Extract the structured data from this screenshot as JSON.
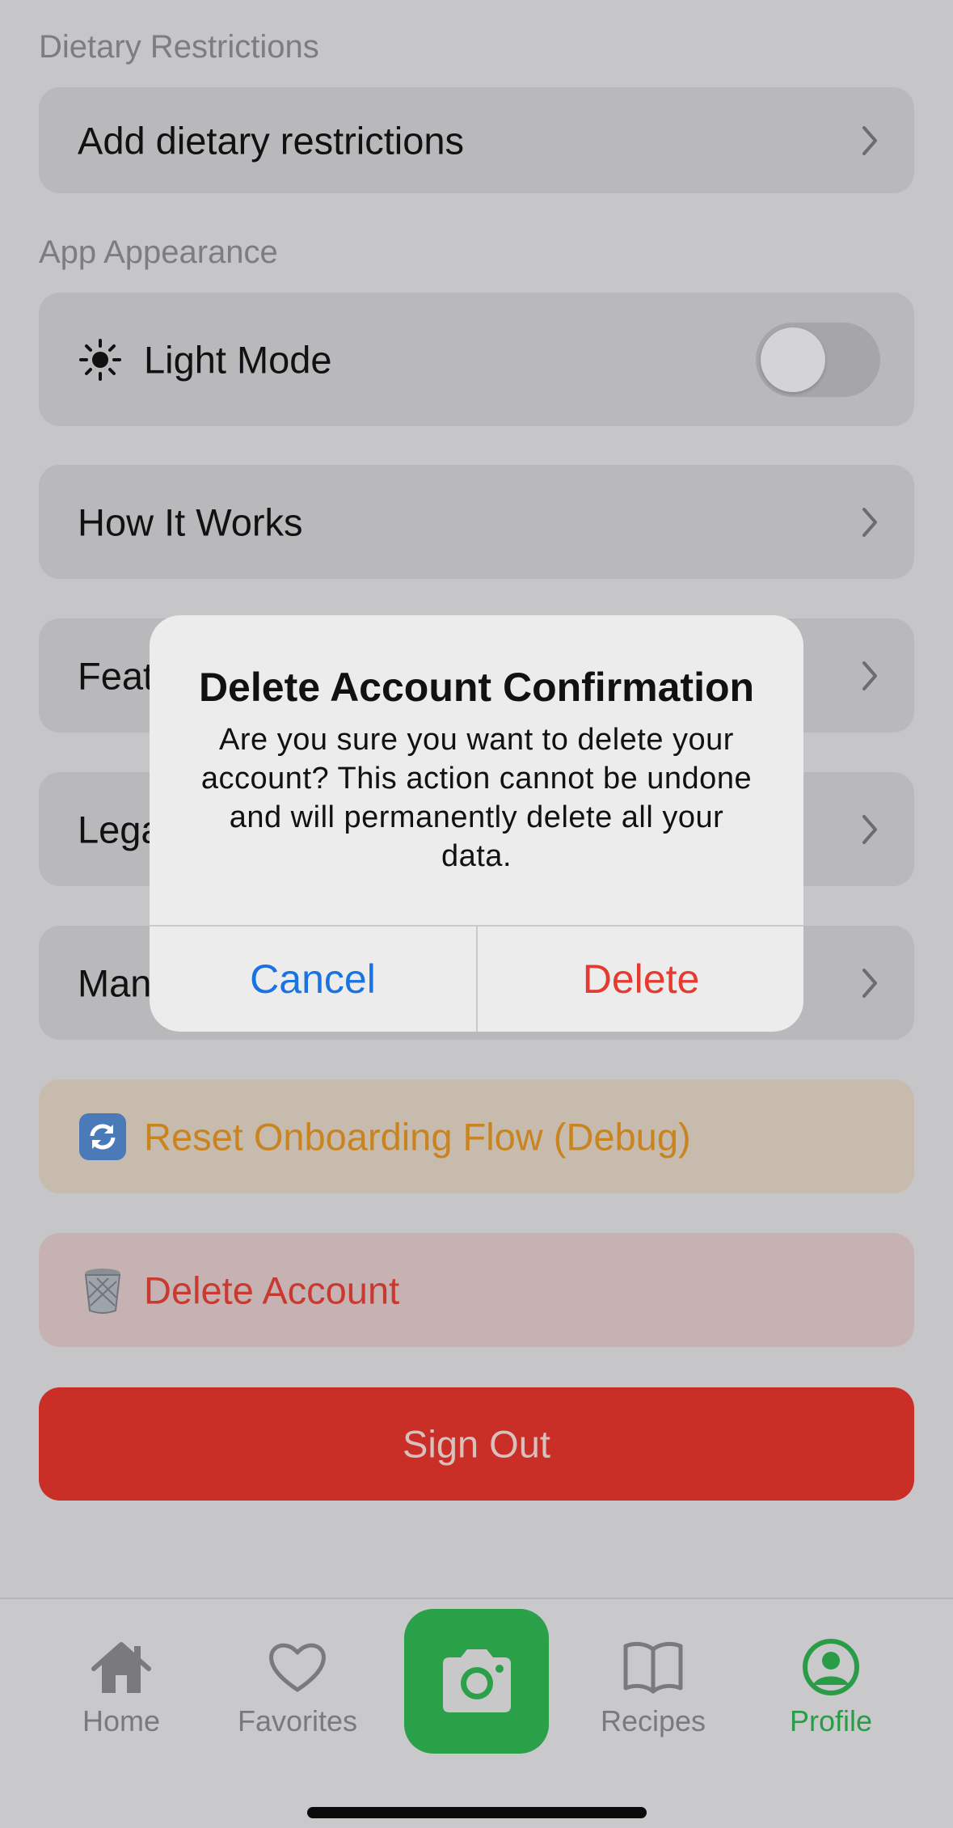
{
  "sections": {
    "dietary_label": "Dietary Restrictions",
    "appearance_label": "App Appearance"
  },
  "rows": {
    "dietary": "Add dietary restrictions",
    "light_mode": "Light Mode",
    "how_it_works": "How It Works",
    "feature_partial": "Feat",
    "legal_partial": "Lega",
    "manage_partial": "Man",
    "reset_onboarding": "Reset Onboarding Flow (Debug)",
    "delete_account": "Delete Account"
  },
  "light_mode_on": false,
  "sign_out": "Sign Out",
  "dialog": {
    "title": "Delete Account Confirmation",
    "message": "Are you sure you want to delete your account? This action cannot be undone and will permanently delete all your data.",
    "cancel": "Cancel",
    "delete": "Delete"
  },
  "tabs": [
    {
      "label": "Home",
      "icon": "house-icon"
    },
    {
      "label": "Favorites",
      "icon": "heart-icon"
    },
    {
      "label": "",
      "icon": "camera-icon"
    },
    {
      "label": "Recipes",
      "icon": "book-icon"
    },
    {
      "label": "Profile",
      "icon": "person-circle-icon",
      "active": true
    }
  ],
  "colors": {
    "accent_green": "#2aa048",
    "danger_red": "#c92f27",
    "link_blue": "#1a73e0"
  }
}
